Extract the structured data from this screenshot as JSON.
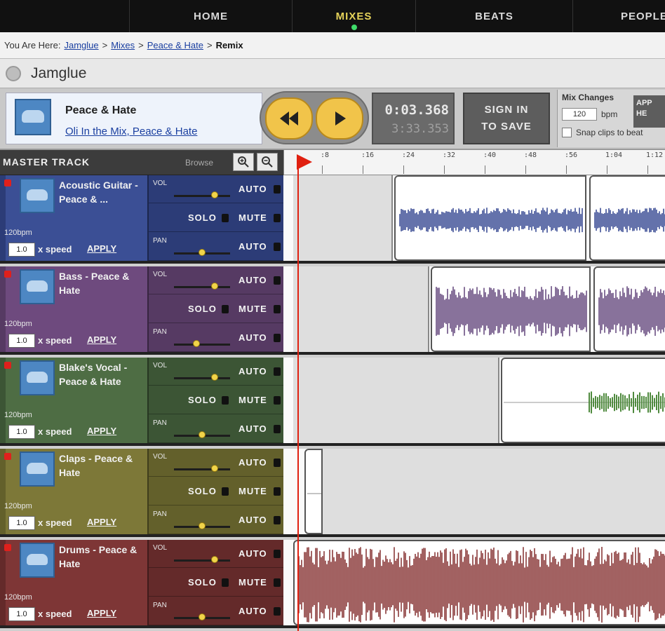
{
  "nav": {
    "items": [
      {
        "label": "HOME",
        "active": false
      },
      {
        "label": "MIXES",
        "active": true
      },
      {
        "label": "BEATS",
        "active": false
      },
      {
        "label": "PEOPLE",
        "active": false
      }
    ]
  },
  "breadcrumb": {
    "prefix": "You Are Here:",
    "items": [
      "Jamglue",
      "Mixes",
      "Peace & Hate"
    ],
    "current": "Remix",
    "separator": ">"
  },
  "app": {
    "name": "Jamglue"
  },
  "song": {
    "title": "Peace & Hate",
    "link": "Oli In the Mix, Peace & Hate"
  },
  "transport": {
    "current_time": "0:03.368",
    "total_time": "3:33.353",
    "sign_in_line1": "SIGN IN",
    "sign_in_line2": "TO SAVE"
  },
  "mix_changes": {
    "title": "Mix Changes",
    "value": "120",
    "unit": "bpm",
    "checkbox_label": "Snap clips to beat",
    "side_label": "APP HE"
  },
  "master": {
    "label": "MASTER TRACK",
    "browse_label": "Browse",
    "zoom_in_icon": "zoom-in-icon",
    "zoom_out_icon": "zoom-out-icon"
  },
  "ruler": {
    "ticks": [
      ":8",
      ":16",
      ":24",
      ":32",
      ":40",
      ":48",
      ":56",
      "1:04",
      "1:12"
    ]
  },
  "playhead_color": "#e02010",
  "tracks": [
    {
      "name": "Acoustic Guitar - Peace & ...",
      "bpm": "120bpm",
      "speed": "1.0",
      "speed_label": "x speed",
      "apply": "APPLY",
      "vol_label": "VOL",
      "pan_label": "PAN",
      "auto_label": "AUTO",
      "solo_label": "SOLO",
      "mute_label": "MUTE",
      "color": "#3b4f95",
      "color_dark": "#2c3c77",
      "wave_color": "#3e4f96",
      "vol": 0.72,
      "pan": 0.5
    },
    {
      "name": "Bass - Peace & Hate",
      "bpm": "120bpm",
      "speed": "1.0",
      "speed_label": "x speed",
      "apply": "APPLY",
      "vol_label": "VOL",
      "pan_label": "PAN",
      "auto_label": "AUTO",
      "solo_label": "SOLO",
      "mute_label": "MUTE",
      "color": "#6e4a7e",
      "color_dark": "#563a63",
      "wave_color": "#6a4f82",
      "vol": 0.72,
      "pan": 0.4
    },
    {
      "name": "Blake's Vocal - Peace & Hate",
      "bpm": "120bpm",
      "speed": "1.0",
      "speed_label": "x speed",
      "apply": "APPLY",
      "vol_label": "VOL",
      "pan_label": "PAN",
      "auto_label": "AUTO",
      "solo_label": "SOLO",
      "mute_label": "MUTE",
      "color": "#4e6d44",
      "color_dark": "#3c5535",
      "wave_color": "#4f8a3e",
      "vol": 0.72,
      "pan": 0.5
    },
    {
      "name": "Claps - Peace & Hate",
      "bpm": "120bpm",
      "speed": "1.0",
      "speed_label": "x speed",
      "apply": "APPLY",
      "vol_label": "VOL",
      "pan_label": "PAN",
      "auto_label": "AUTO",
      "solo_label": "SOLO",
      "mute_label": "MUTE",
      "color": "#7d7838",
      "color_dark": "#63602b",
      "wave_color": "#7d7838",
      "vol": 0.72,
      "pan": 0.5
    },
    {
      "name": "Drums - Peace & Hate",
      "bpm": "120bpm",
      "speed": "1.0",
      "speed_label": "x speed",
      "apply": "APPLY",
      "vol_label": "VOL",
      "pan_label": "PAN",
      "auto_label": "AUTO",
      "solo_label": "SOLO",
      "mute_label": "MUTE",
      "color": "#7e3636",
      "color_dark": "#642a2a",
      "wave_color": "#8b3a3a",
      "vol": 0.72,
      "pan": 0.5
    }
  ]
}
